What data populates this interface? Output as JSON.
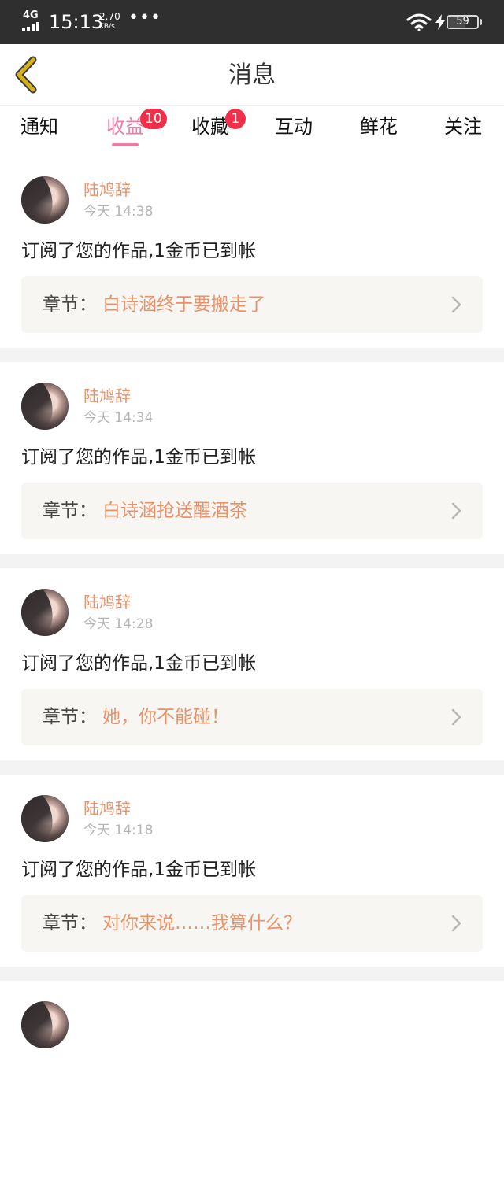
{
  "status_bar": {
    "network": "4G",
    "time": "15:13",
    "speed_value": "2.70",
    "speed_unit": "KB/s",
    "dots": "•••",
    "battery_level": 59,
    "battery_text": "59",
    "icons": [
      "signal-icon",
      "wifi-icon",
      "charging-icon",
      "battery-icon"
    ]
  },
  "header": {
    "title": "消息",
    "back_icon": "chevron-left-icon",
    "back_color": "#d8b21a"
  },
  "tabs": [
    {
      "label": "通知",
      "badge": ""
    },
    {
      "label": "收益",
      "badge": "10",
      "active": true
    },
    {
      "label": "收藏",
      "badge": "1"
    },
    {
      "label": "互动",
      "badge": ""
    },
    {
      "label": "鲜花",
      "badge": ""
    },
    {
      "label": "关注",
      "badge": ""
    }
  ],
  "colors": {
    "accent_pink": "#f07aa6",
    "badge_red": "#f0304a",
    "name_orange": "#e8926a"
  },
  "messages": [
    {
      "user": "陆鸠辞",
      "time": "今天 14:38",
      "text": "订阅了您的作品,1金币已到帐",
      "chapter_label": "章节：",
      "chapter_title": "白诗涵终于要搬走了"
    },
    {
      "user": "陆鸠辞",
      "time": "今天 14:34",
      "text": "订阅了您的作品,1金币已到帐",
      "chapter_label": "章节：",
      "chapter_title": "白诗涵抢送醒酒茶"
    },
    {
      "user": "陆鸠辞",
      "time": "今天 14:28",
      "text": "订阅了您的作品,1金币已到帐",
      "chapter_label": "章节：",
      "chapter_title": "她，你不能碰！"
    },
    {
      "user": "陆鸠辞",
      "time": "今天 14:18",
      "text": "订阅了您的作品,1金币已到帐",
      "chapter_label": "章节：",
      "chapter_title": "对你来说……我算什么？"
    }
  ]
}
